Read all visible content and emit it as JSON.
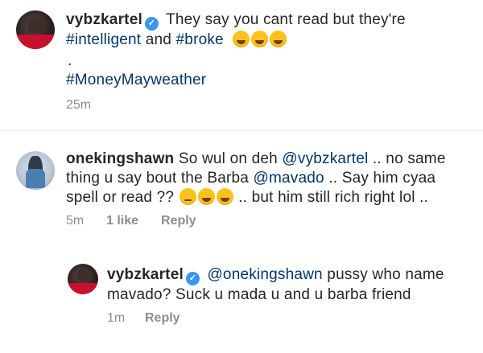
{
  "post": {
    "username": "vybzkartel",
    "caption": "They say you cant read but they're",
    "hashtag1": "#intelligent",
    "and_word": "and",
    "hashtag2": "#broke",
    "dot": ".",
    "hashtag3": "#MoneyMayweather",
    "time": "25m"
  },
  "comments": [
    {
      "username": "onekingshawn",
      "text_part1": "So wul on deh",
      "mention1": "@vybzkartel",
      "text_part2": ".. no same thing u say bout the Barba",
      "mention2": "@mavado",
      "text_part3": ".. Say him cyaa spell or read ??",
      "text_part4": ".. but him still rich right lol ..",
      "time": "5m",
      "likes": "1 like",
      "reply_label": "Reply"
    },
    {
      "username": "vybzkartel",
      "mention": "@onekingshawn",
      "text": "pussy who name mavado? Suck u mada u and u barba friend",
      "time": "1m",
      "reply_label": "Reply"
    }
  ],
  "icons": {
    "verified": "verified-badge-icon",
    "emoji_rofl": "rolling-on-floor-laughing-emoji",
    "emoji_joy": "tears-of-joy-emoji",
    "emoji_thinking": "thinking-face-emoji"
  },
  "colors": {
    "text": "#262626",
    "link": "#003569",
    "meta": "#8e8e8e",
    "verified": "#3897f0",
    "divider": "#efefef"
  }
}
